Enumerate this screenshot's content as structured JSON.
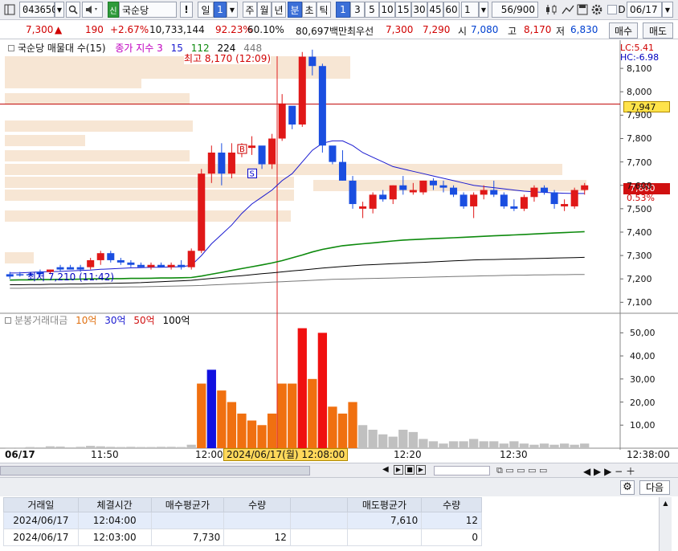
{
  "toolbar": {
    "code": "043650",
    "stock_badge": "신",
    "stock_name": "국순당",
    "exclaim": "!",
    "period_day": "일",
    "period_num": "1",
    "periods": [
      "주",
      "월",
      "년",
      "분",
      "초",
      "틱"
    ],
    "active_period": "분",
    "intervals": [
      "1",
      "3",
      "5",
      "10",
      "15",
      "30",
      "45",
      "60"
    ],
    "interval_value": "1",
    "count": "56/900",
    "d_label": "D",
    "date": "06/17"
  },
  "quote": {
    "price": "7,300",
    "direction": "▲",
    "change": "190",
    "change_pct": "+2.67%",
    "volume": "10,733,144",
    "ratio1": "92.23%",
    "ratio2": "60.10%",
    "amount": "80,697백만",
    "best_label": "최우선",
    "best_ask": "7,300",
    "best_bid": "7,290",
    "open_label": "시",
    "open": "7,080",
    "high_label": "고",
    "high": "8,170",
    "low_label": "저",
    "low": "6,830",
    "buy_button": "매수",
    "sell_button": "매도"
  },
  "price_panel": {
    "legend_title": "국순당 매물대 수(15)",
    "legend_ma": "종가 지수 3",
    "legend_periods": [
      "15",
      "112",
      "224",
      "448"
    ],
    "legend_colors": [
      "#1a1ad0",
      "#0d8a0d",
      "#000000",
      "#777777"
    ],
    "lc_label": "LC:5.41",
    "hc_label": "HC:-6.98",
    "high_annot": "최고 8,170 (12:09)",
    "low_annot": "최저 7,210 (11:42)",
    "marker_b": "B",
    "marker_s": "S",
    "ref_price": "7,947",
    "last_price": "7,600",
    "last_pct": "0.53%",
    "y_ticks": [
      "8,100",
      "8,000",
      "7,900",
      "7,800",
      "7,700",
      "7,600",
      "7,500",
      "7,400",
      "7,300",
      "7,200",
      "7,100"
    ]
  },
  "volume_panel": {
    "legend_title": "분봉거래대금",
    "legend_items": [
      "10억",
      "30억",
      "50억",
      "100억"
    ],
    "legend_colors": [
      "#e07010",
      "#1a1ad0",
      "#d01010",
      "#000000"
    ],
    "y_ticks": [
      "50,00",
      "40,00",
      "30,00",
      "20,00",
      "10,00"
    ]
  },
  "x_axis": {
    "labels": [
      "06/17",
      "11:50",
      "12:00",
      "12:20",
      "12:30",
      "12:38:00"
    ],
    "cursor_label": "2024/06/17(월) 12:08:00"
  },
  "chart_data": {
    "type": "candlestick",
    "price_candles": [
      [
        7210,
        7230,
        7200,
        7220
      ],
      [
        7220,
        7230,
        7210,
        7220
      ],
      [
        7220,
        7230,
        7210,
        7220
      ],
      [
        7220,
        7240,
        7210,
        7230
      ],
      [
        7230,
        7240,
        7220,
        7240
      ],
      [
        7240,
        7260,
        7230,
        7250
      ],
      [
        7250,
        7260,
        7240,
        7240
      ],
      [
        7240,
        7260,
        7230,
        7250
      ],
      [
        7250,
        7290,
        7240,
        7280
      ],
      [
        7280,
        7320,
        7260,
        7310
      ],
      [
        7310,
        7320,
        7270,
        7280
      ],
      [
        7280,
        7290,
        7260,
        7270
      ],
      [
        7270,
        7280,
        7250,
        7260
      ],
      [
        7260,
        7270,
        7250,
        7250
      ],
      [
        7250,
        7270,
        7240,
        7260
      ],
      [
        7260,
        7270,
        7250,
        7250
      ],
      [
        7250,
        7270,
        7240,
        7260
      ],
      [
        7260,
        7280,
        7240,
        7250
      ],
      [
        7250,
        7330,
        7240,
        7320
      ],
      [
        7320,
        7670,
        7310,
        7650
      ],
      [
        7650,
        7770,
        7610,
        7740
      ],
      [
        7740,
        7780,
        7600,
        7650
      ],
      [
        7650,
        7780,
        7630,
        7740
      ],
      [
        7740,
        7780,
        7720,
        7770
      ],
      [
        7760,
        7810,
        7730,
        7770
      ],
      [
        7770,
        7760,
        7670,
        7690
      ],
      [
        7690,
        7820,
        7670,
        7800
      ],
      [
        7800,
        7990,
        7790,
        7950
      ],
      [
        7940,
        7900,
        7840,
        7860
      ],
      [
        7860,
        8170,
        7850,
        8150
      ],
      [
        8150,
        8180,
        8070,
        8110
      ],
      [
        8110,
        8120,
        7740,
        7770
      ],
      [
        7770,
        7750,
        7690,
        7700
      ],
      [
        7700,
        7750,
        7620,
        7620
      ],
      [
        7620,
        7640,
        7500,
        7520
      ],
      [
        7510,
        7530,
        7460,
        7500
      ],
      [
        7500,
        7570,
        7480,
        7560
      ],
      [
        7560,
        7580,
        7530,
        7540
      ],
      [
        7540,
        7600,
        7520,
        7600
      ],
      [
        7600,
        7640,
        7560,
        7580
      ],
      [
        7580,
        7610,
        7560,
        7570
      ],
      [
        7570,
        7620,
        7560,
        7620
      ],
      [
        7620,
        7630,
        7580,
        7600
      ],
      [
        7600,
        7620,
        7570,
        7590
      ],
      [
        7590,
        7600,
        7550,
        7560
      ],
      [
        7560,
        7570,
        7500,
        7510
      ],
      [
        7510,
        7570,
        7460,
        7560
      ],
      [
        7560,
        7600,
        7540,
        7580
      ],
      [
        7580,
        7620,
        7550,
        7560
      ],
      [
        7560,
        7570,
        7500,
        7510
      ],
      [
        7510,
        7540,
        7490,
        7500
      ],
      [
        7500,
        7560,
        7490,
        7550
      ],
      [
        7550,
        7600,
        7530,
        7590
      ],
      [
        7590,
        7600,
        7560,
        7570
      ],
      [
        7570,
        7580,
        7500,
        7520
      ],
      [
        7520,
        7540,
        7490,
        7510
      ],
      [
        7510,
        7590,
        7500,
        7580
      ],
      [
        7580,
        7610,
        7560,
        7600
      ]
    ],
    "candle_colors": [
      "blue",
      "blue",
      "blue",
      "blue",
      "red",
      "blue",
      "blue",
      "blue",
      "red",
      "red",
      "blue",
      "blue",
      "blue",
      "blue",
      "red",
      "blue",
      "red",
      "blue",
      "red",
      "red",
      "red",
      "blue",
      "red",
      "red",
      "red",
      "blue",
      "red",
      "red",
      "blue",
      "red",
      "blue",
      "blue",
      "blue",
      "blue",
      "blue",
      "red",
      "red",
      "blue",
      "red",
      "blue",
      "red",
      "red",
      "blue",
      "blue",
      "blue",
      "blue",
      "red",
      "red",
      "blue",
      "blue",
      "blue",
      "red",
      "red",
      "blue",
      "blue",
      "red",
      "red",
      "red"
    ],
    "volumes": [
      0.3,
      0.3,
      0.5,
      0.4,
      0.8,
      0.7,
      0.4,
      0.6,
      1,
      0.8,
      0.6,
      0.5,
      0.6,
      0.5,
      0.5,
      0.6,
      0.6,
      0.5,
      1.5,
      28,
      34,
      25,
      20,
      15,
      12,
      10,
      15,
      28,
      28,
      52,
      30,
      50,
      18,
      15,
      20,
      10,
      8,
      6,
      5,
      8,
      7,
      4,
      3,
      2,
      3,
      3,
      4,
      3,
      3,
      2,
      3,
      2,
      1.5,
      2,
      1.5,
      2,
      1.5,
      2
    ],
    "volume_colors": [
      "gray",
      "gray",
      "gray",
      "gray",
      "gray",
      "gray",
      "gray",
      "gray",
      "gray",
      "gray",
      "gray",
      "gray",
      "gray",
      "gray",
      "gray",
      "gray",
      "gray",
      "gray",
      "gray",
      "orange",
      "blue",
      "orange",
      "orange",
      "orange",
      "orange",
      "orange",
      "orange",
      "orange",
      "orange",
      "red",
      "orange",
      "red",
      "orange",
      "orange",
      "orange",
      "gray",
      "gray",
      "gray",
      "gray",
      "gray",
      "gray",
      "gray",
      "gray",
      "gray",
      "gray",
      "gray",
      "gray",
      "gray",
      "gray",
      "gray",
      "gray",
      "gray",
      "gray",
      "gray",
      "gray",
      "gray",
      "gray",
      "gray"
    ],
    "ma15": [
      7225,
      7226,
      7228,
      7230,
      7231,
      7232,
      7234,
      7236,
      7238,
      7241,
      7243,
      7245,
      7247,
      7248,
      7250,
      7250,
      7251,
      7252,
      7258,
      7300,
      7350,
      7390,
      7430,
      7480,
      7520,
      7550,
      7580,
      7620,
      7650,
      7700,
      7750,
      7780,
      7790,
      7790,
      7770,
      7740,
      7720,
      7700,
      7680,
      7670,
      7660,
      7650,
      7640,
      7630,
      7620,
      7610,
      7600,
      7595,
      7590,
      7585,
      7580,
      7575,
      7572,
      7570,
      7568,
      7566,
      7565,
      7565
    ],
    "ma112": [
      7195,
      7196,
      7196,
      7197,
      7197,
      7198,
      7198,
      7199,
      7200,
      7200,
      7201,
      7201,
      7202,
      7202,
      7203,
      7204,
      7204,
      7205,
      7206,
      7212,
      7220,
      7228,
      7236,
      7244,
      7252,
      7260,
      7268,
      7278,
      7290,
      7302,
      7315,
      7326,
      7334,
      7342,
      7346,
      7350,
      7354,
      7358,
      7362,
      7366,
      7368,
      7370,
      7372,
      7374,
      7376,
      7378,
      7380,
      7382,
      7384,
      7386,
      7388,
      7390,
      7392,
      7394,
      7396,
      7398,
      7400,
      7402
    ],
    "ma224": [
      7175,
      7175,
      7176,
      7176,
      7177,
      7177,
      7178,
      7178,
      7179,
      7180,
      7181,
      7182,
      7183,
      7184,
      7186,
      7188,
      7190,
      7192,
      7194,
      7198,
      7202,
      7206,
      7210,
      7214,
      7218,
      7222,
      7226,
      7230,
      7234,
      7238,
      7242,
      7246,
      7250,
      7253,
      7256,
      7259,
      7261,
      7263,
      7265,
      7267,
      7269,
      7271,
      7273,
      7275,
      7277,
      7279,
      7281,
      7282,
      7283,
      7284,
      7285,
      7286,
      7287,
      7288,
      7289,
      7290,
      7291,
      7292
    ],
    "ma448": [
      7160,
      7160,
      7161,
      7161,
      7162,
      7162,
      7163,
      7163,
      7164,
      7164,
      7165,
      7165,
      7166,
      7166,
      7167,
      7168,
      7169,
      7170,
      7171,
      7172,
      7174,
      7176,
      7178,
      7180,
      7182,
      7184,
      7186,
      7188,
      7190,
      7192,
      7194,
      7196,
      7198,
      7199,
      7200,
      7201,
      7202,
      7203,
      7204,
      7205,
      7206,
      7207,
      7208,
      7209,
      7210,
      7211,
      7212,
      7213,
      7214,
      7215,
      7216,
      7216,
      7217,
      7217,
      7218,
      7218,
      7219,
      7219
    ],
    "ylim": [
      7060,
      8200
    ],
    "volume_ylim": [
      0,
      55
    ]
  },
  "table": {
    "headers": [
      "거래일",
      "체결시간",
      "매수평균가",
      "수량",
      "",
      "매도평균가",
      "수량"
    ],
    "rows": [
      [
        "2024/06/17",
        "12:04:00",
        "",
        "",
        "",
        "7,610",
        "12"
      ],
      [
        "2024/06/17",
        "12:03:00",
        "7,730",
        "12",
        "",
        "",
        "0"
      ]
    ]
  },
  "bottom": {
    "next_button": "다음"
  }
}
